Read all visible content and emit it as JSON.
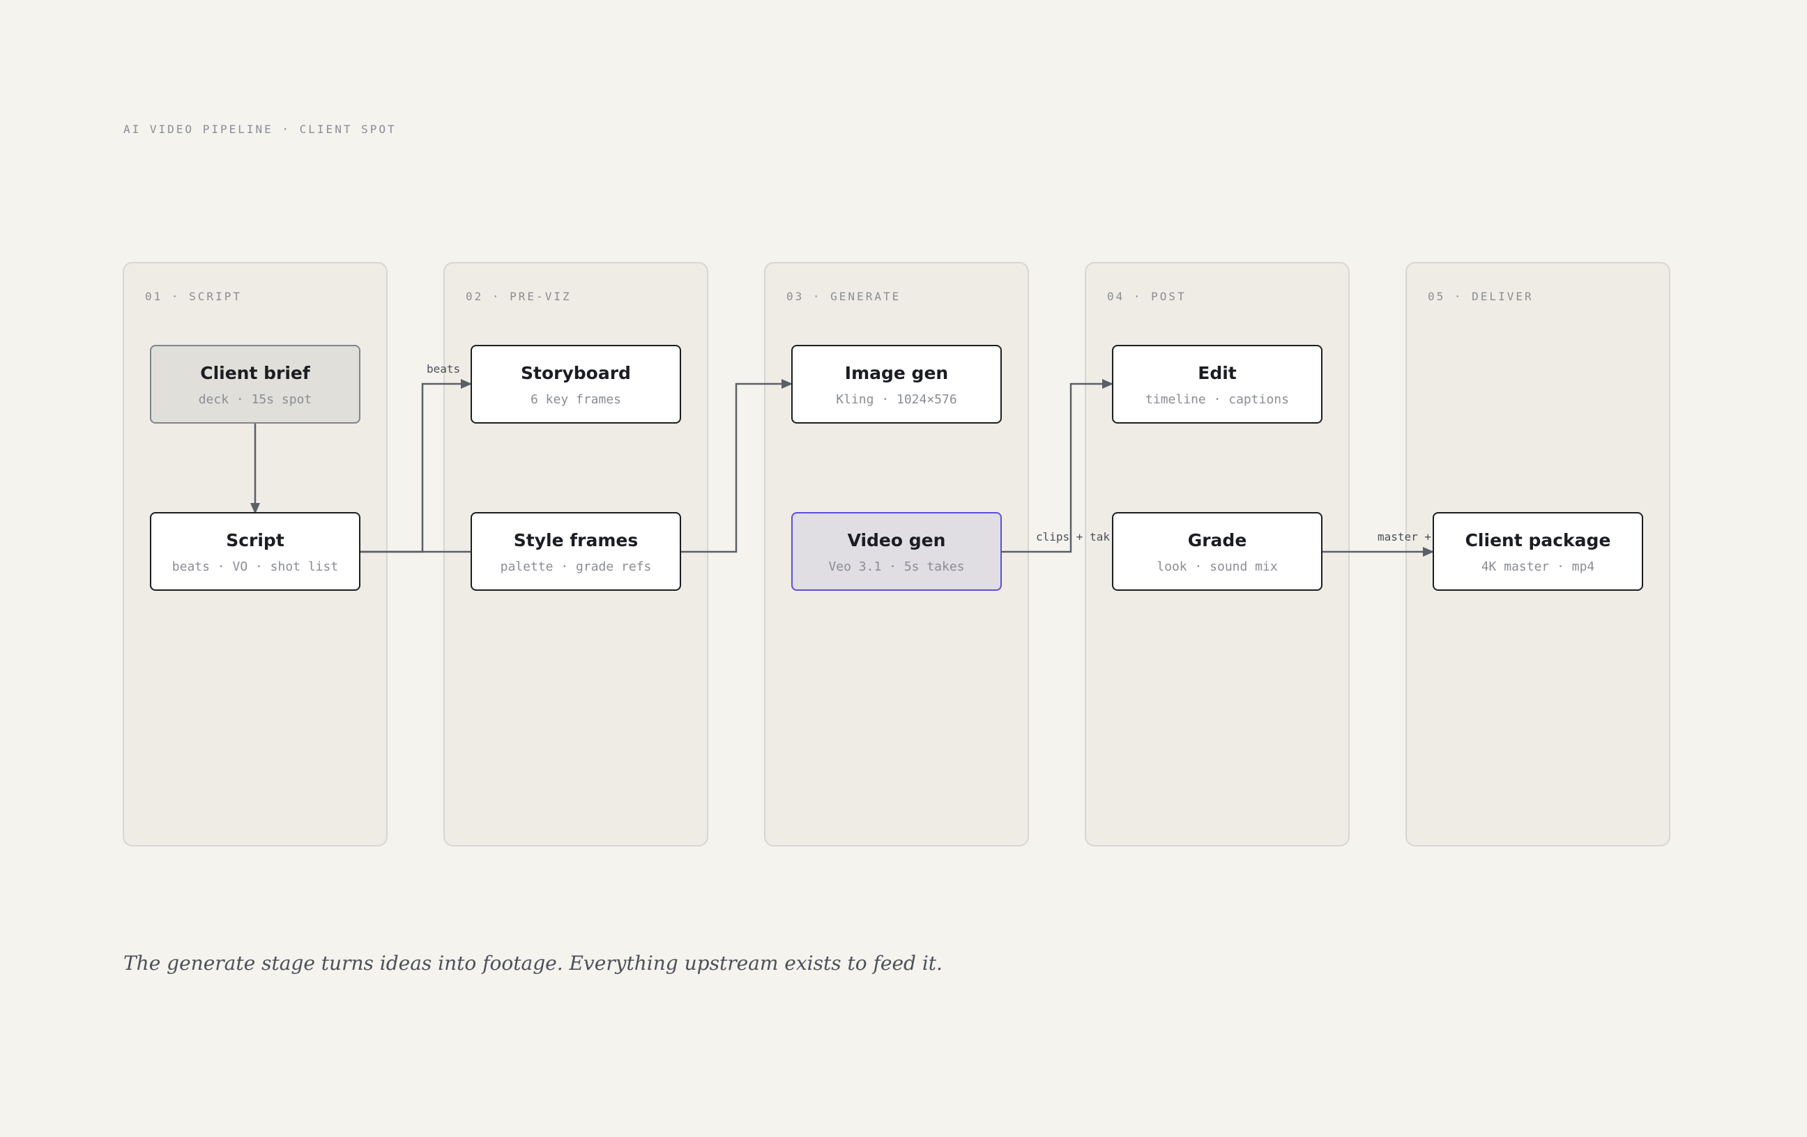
{
  "title": "AI VIDEO PIPELINE · CLIENT SPOT",
  "lanes": [
    {
      "label": "01 · SCRIPT"
    },
    {
      "label": "02 · PRE-VIZ"
    },
    {
      "label": "03 · GENERATE"
    },
    {
      "label": "04 · POST"
    },
    {
      "label": "05 · DELIVER"
    }
  ],
  "nodes": {
    "client_brief": {
      "title": "Client brief",
      "sub": "deck · 15s spot"
    },
    "script": {
      "title": "Script",
      "sub": "beats · VO · shot list"
    },
    "storyboard": {
      "title": "Storyboard",
      "sub": "6 key frames"
    },
    "style_frames": {
      "title": "Style frames",
      "sub": "palette · grade refs"
    },
    "image_gen": {
      "title": "Image gen",
      "sub": "Kling · 1024×576"
    },
    "video_gen": {
      "title": "Video gen",
      "sub": "Veo 3.1 · 5s takes"
    },
    "edit": {
      "title": "Edit",
      "sub": "timeline · captions"
    },
    "grade": {
      "title": "Grade",
      "sub": "look · sound mix"
    },
    "client_package": {
      "title": "Client package",
      "sub": "4K master · mp4"
    }
  },
  "edge_labels": {
    "beats": "beats",
    "clips_takes": "clips + tak",
    "master": "master +"
  },
  "caption": "The generate stage turns ideas into footage. Everything upstream exists to feed it.",
  "colors": {
    "background": "#f4f3ee",
    "lane": "#efece5",
    "edge": "#5a5f68",
    "accent": "#5b50d6"
  }
}
